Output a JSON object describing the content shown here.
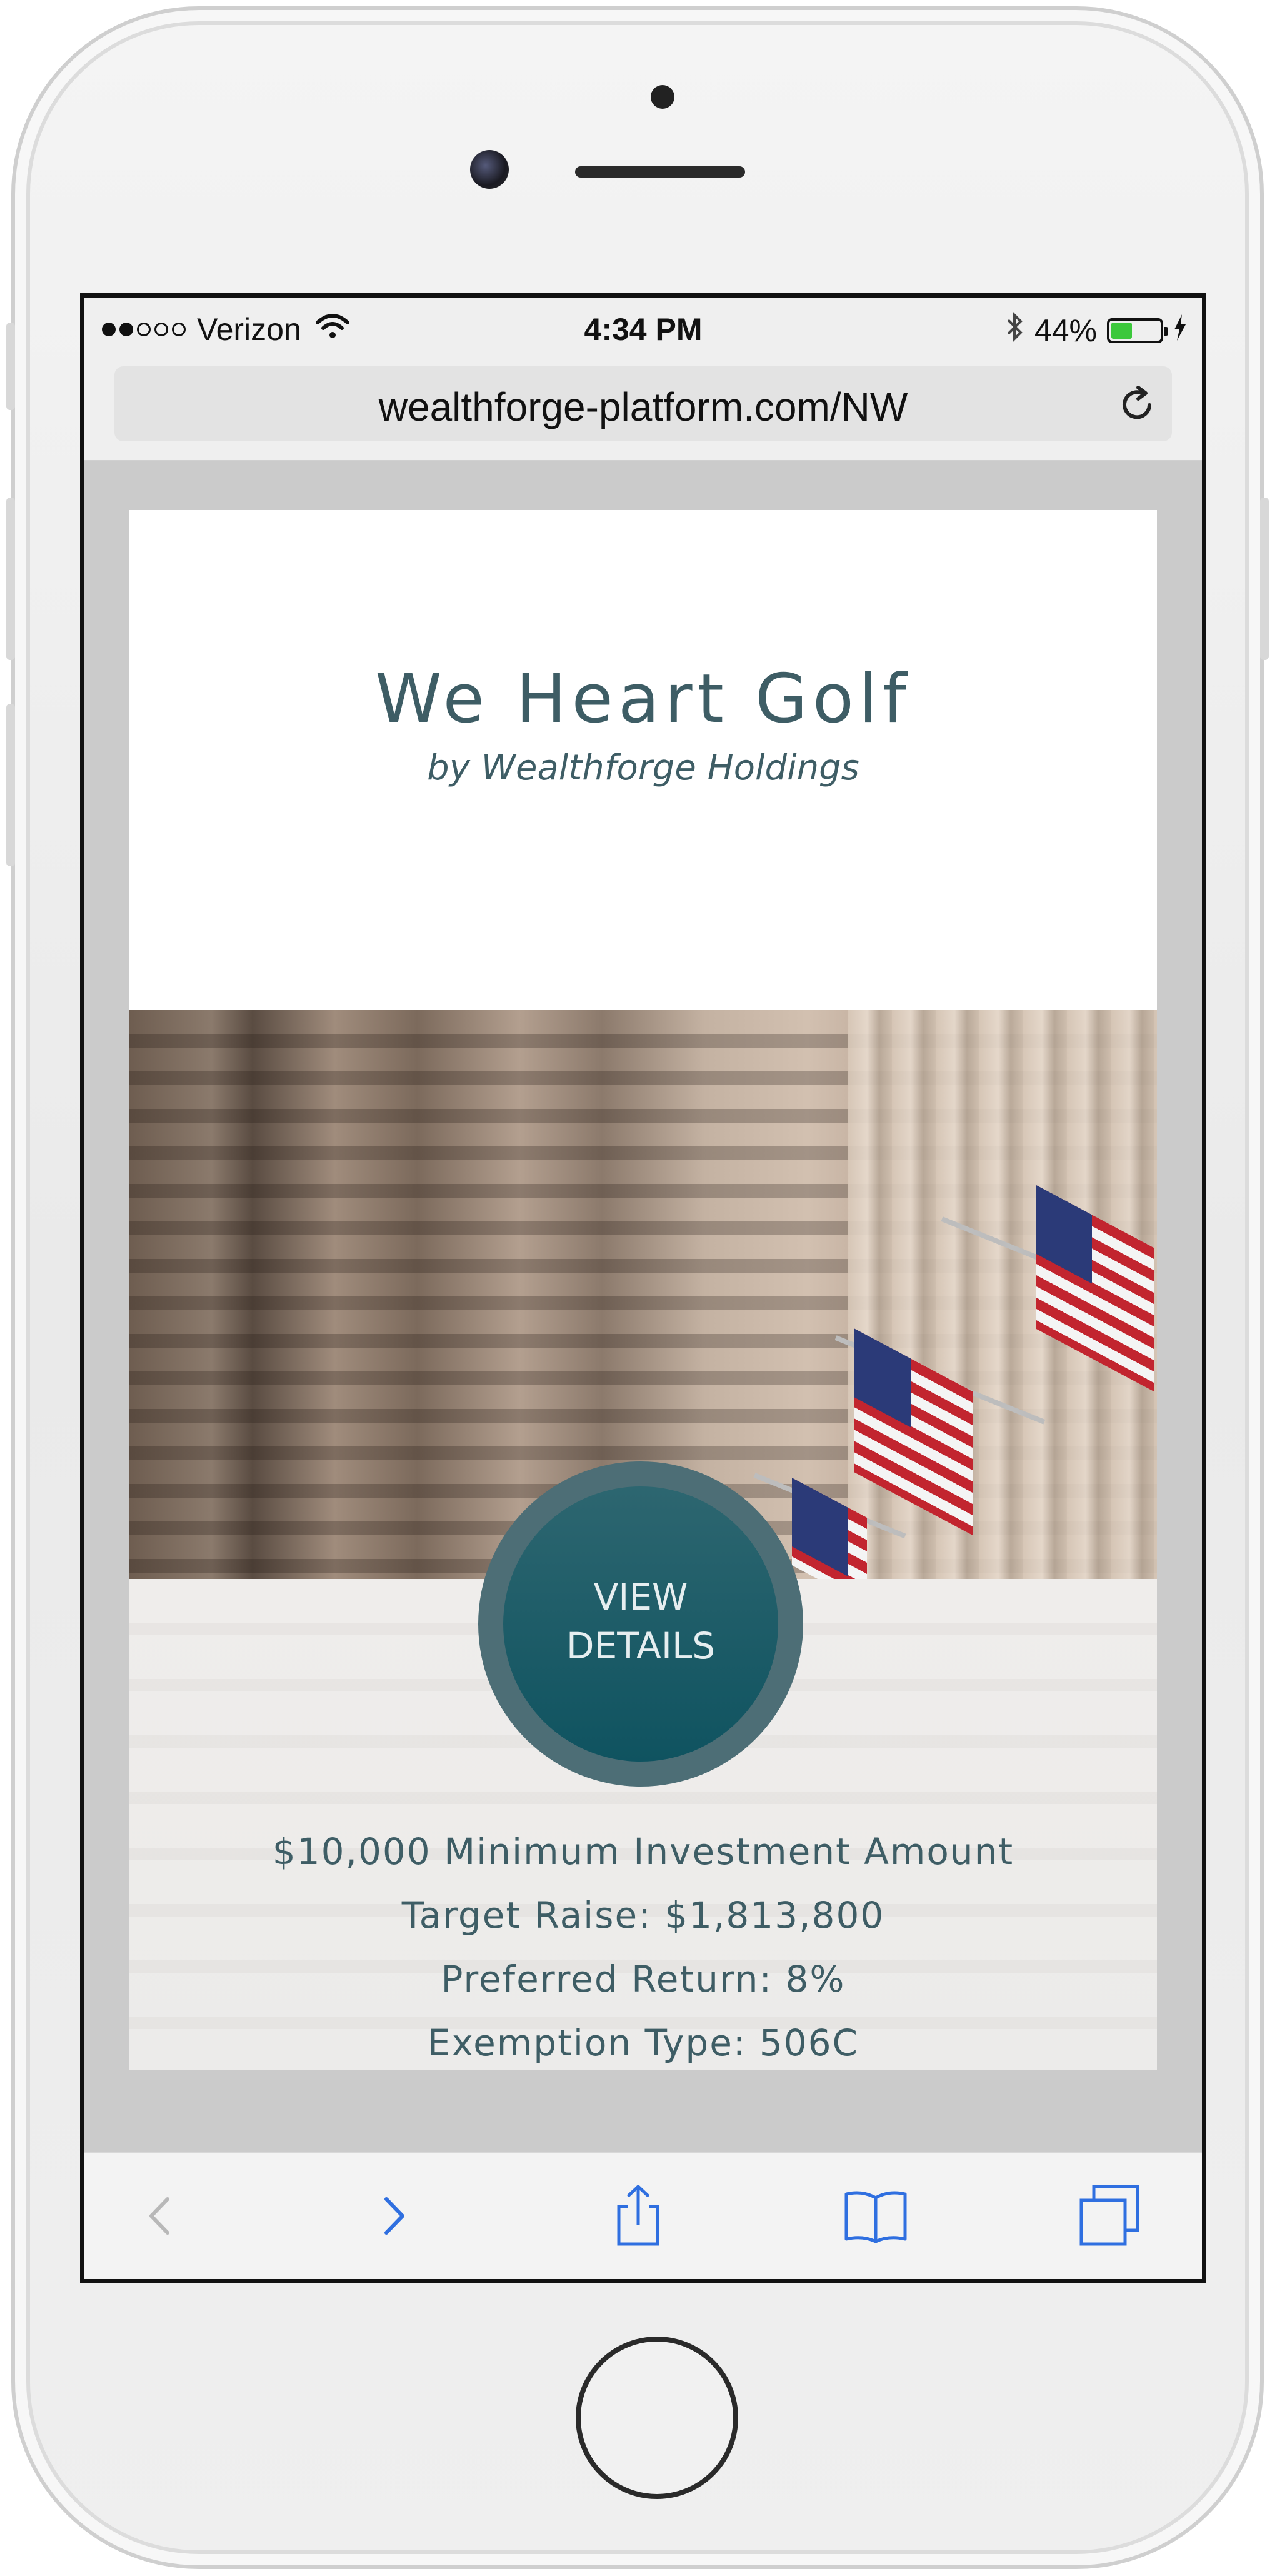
{
  "status_bar": {
    "carrier": "Verizon",
    "time": "4:34 PM",
    "battery_percent": "44%",
    "battery_level": 0.44,
    "signal_bars_filled": 2,
    "signal_bars_total": 5
  },
  "browser": {
    "url": "wealthforge-platform.com/NW"
  },
  "offering": {
    "title": "We Heart Golf",
    "subtitle": "by Wealthforge Holdings",
    "cta_label": "VIEW\nDETAILS",
    "minimum_investment": "$10,000 Minimum Investment Amount",
    "target_raise": "Target Raise: $1,813,800",
    "preferred_return": "Preferred Return: 8%",
    "exemption_type": "Exemption Type: 506C"
  },
  "colors": {
    "brand_text": "#3e5d65",
    "cta_ring": "#4d6e76",
    "cta_fill": "#0f5360",
    "toolbar_active": "#2f6fe0",
    "toolbar_disabled": "#b8b8b8",
    "battery_fill": "#3cc83c"
  },
  "icons": {
    "back": "chevron-left-icon",
    "forward": "chevron-right-icon",
    "share": "share-icon",
    "bookmarks": "book-icon",
    "tabs": "tabs-icon",
    "reload": "reload-icon",
    "wifi": "wifi-icon",
    "bluetooth": "bluetooth-icon",
    "charging": "bolt-icon"
  }
}
